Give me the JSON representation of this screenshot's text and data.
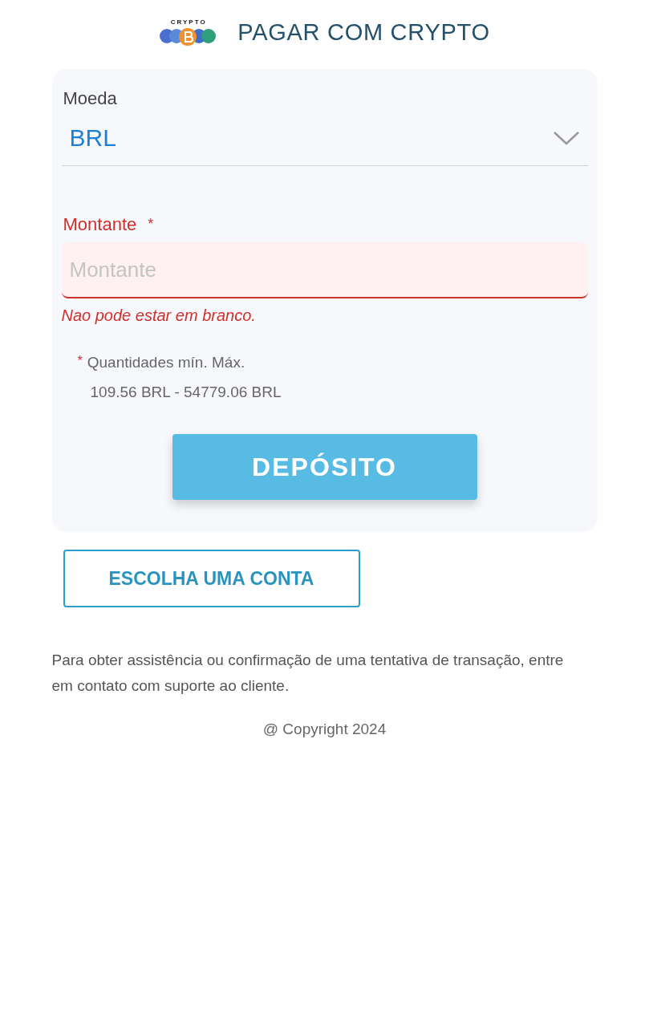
{
  "header": {
    "logo_text": "CRYPTO",
    "title": "PAGAR COM CRYPTO"
  },
  "form": {
    "currency": {
      "label": "Moeda",
      "value": "BRL"
    },
    "amount": {
      "label": "Montante",
      "required_mark": "*",
      "placeholder": "Montante",
      "error": "Nao pode estar em branco.",
      "invalid": true
    },
    "limits": {
      "mark": "*",
      "line_1": "Quantidades mín. Máx.",
      "line_2": "109.56 BRL - 54779.06 BRL"
    },
    "submit": "DEPÓSITO"
  },
  "choose_account": "ESCOLHA UMA CONTA",
  "help_text": "Para obter assistência ou confirmação de uma tentativa de transação, entre em contato com suporte ao cliente.",
  "copyright": "@ Copyright 2024"
}
